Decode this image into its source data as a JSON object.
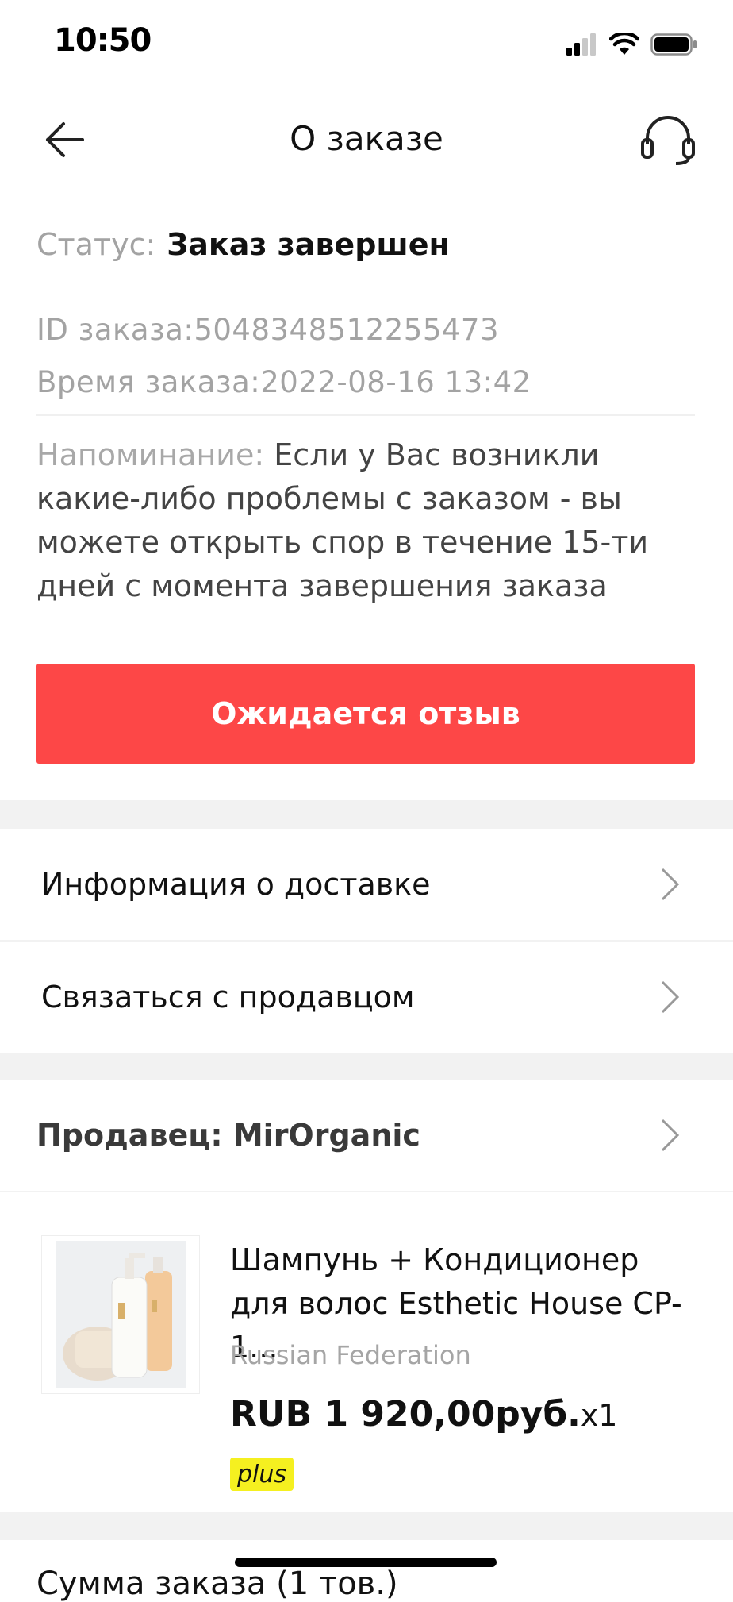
{
  "status_bar": {
    "time": "10:50"
  },
  "header": {
    "title": "О заказе"
  },
  "status": {
    "label": "Статус:",
    "value": "Заказ завершен"
  },
  "order": {
    "id_text": "ID заказа:5048348512255473",
    "time_text": "Время заказа:2022-08-16 13:42"
  },
  "reminder": {
    "label": "Напоминание:",
    "text": "Если у Вас возникли какие-либо проблемы с заказом - вы можете открыть спор в течение 15-ти дней с момента завершения заказа"
  },
  "cta": {
    "label": "Ожидается отзыв",
    "color": "#fd4747"
  },
  "links": {
    "delivery": "Информация о доставке",
    "contact": "Связаться с продавцом"
  },
  "seller": {
    "label": "Продавец: MirOrganic"
  },
  "product": {
    "title": "Шампунь + Кондиционер для волос Esthetic House CP-1...",
    "country": "Russian Federation",
    "price": "RUB 1 920,00руб.",
    "qty": "x1",
    "badge": "plus"
  },
  "summary": {
    "label": "Сумма заказа (1 тов.)"
  },
  "icons": [
    "signal-icon",
    "wifi-icon",
    "battery-icon",
    "back-arrow-icon",
    "headset-icon",
    "chevron-right-icon"
  ]
}
